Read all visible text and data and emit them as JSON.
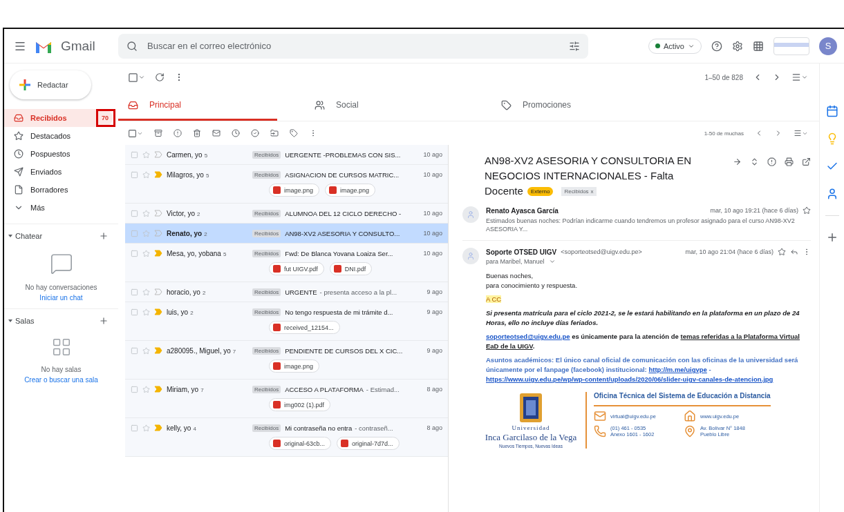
{
  "app": {
    "name": "Gmail"
  },
  "search": {
    "placeholder": "Buscar en el correo electrónico"
  },
  "status": {
    "label": "Activo"
  },
  "account": {
    "initial": "S"
  },
  "compose": {
    "label": "Redactar"
  },
  "sidebar": {
    "items": [
      {
        "kind": "inbox",
        "label": "Recibidos",
        "count": "70",
        "selected": true,
        "highlighted": true
      },
      {
        "kind": "starred",
        "label": "Destacados",
        "selected": false
      },
      {
        "kind": "snoozed",
        "label": "Pospuestos",
        "selected": false
      },
      {
        "kind": "sent",
        "label": "Enviados",
        "selected": false
      },
      {
        "kind": "drafts",
        "label": "Borradores",
        "selected": false
      },
      {
        "kind": "more",
        "label": "Más",
        "selected": false
      }
    ]
  },
  "chat": {
    "title": "Chatear",
    "empty": "No hay conversaciones",
    "link": "Iniciar un chat"
  },
  "rooms": {
    "title": "Salas",
    "empty": "No hay salas",
    "link": "Crear o buscar una sala"
  },
  "toolbar": {
    "range": "1–50 de 828"
  },
  "tabs": [
    {
      "kind": "primary",
      "label": "Principal",
      "selected": true
    },
    {
      "kind": "social",
      "label": "Social",
      "selected": false
    },
    {
      "kind": "promotions",
      "label": "Promociones",
      "selected": false
    }
  ],
  "list_toolbar": {
    "range": "1-50 de muchas"
  },
  "emails": [
    {
      "sender": "Carmen, yo",
      "count": "5",
      "label": "Recibidos",
      "subject": "UERGENTE -PROBLEMAS CON SIS...",
      "date": "10 ago",
      "important": false,
      "selected": false
    },
    {
      "sender": "Milagros, yo",
      "count": "5",
      "label": "Recibidos",
      "subject": "ASIGNACION DE CURSOS MATRIC...",
      "date": "10 ago",
      "important": true,
      "selected": false,
      "attachments": [
        "image.png",
        "image.png"
      ]
    },
    {
      "sender": "Victor, yo",
      "count": "2",
      "label": "Recibidos",
      "subject": "ALUMNOA DEL 12 CICLO DERECHO -",
      "date": "10 ago",
      "important": false,
      "selected": false
    },
    {
      "sender": "Renato, yo",
      "count": "2",
      "label": "Recibidos",
      "subject": "AN98-XV2 ASESORIA Y CONSULTO...",
      "date": "10 ago",
      "important": false,
      "selected": true
    },
    {
      "sender": "Mesa, yo, yobana",
      "count": "5",
      "label": "Recibidos",
      "subject": "Fwd: De Blanca Yovana Loaiza Ser...",
      "date": "10 ago",
      "important": true,
      "selected": false,
      "attachments": [
        "fut UIGV.pdf",
        "DNI.pdf"
      ]
    },
    {
      "sender": "horacio, yo",
      "count": "2",
      "label": "Recibidos",
      "subject": "URGENTE",
      "snippet": "- presenta acceso a la pl...",
      "date": "9 ago",
      "important": false,
      "selected": false
    },
    {
      "sender": "luis, yo",
      "count": "2",
      "label": "Recibidos",
      "subject": "No tengo respuesta de mi trámite d...",
      "date": "9 ago",
      "important": true,
      "selected": false,
      "attachments": [
        "received_12154..."
      ]
    },
    {
      "sender": "a280095., Miguel, yo",
      "count": "7",
      "label": "Recibidos",
      "subject": "PENDIENTE DE CURSOS DEL X CIC...",
      "date": "9 ago",
      "important": true,
      "selected": false,
      "attachments": [
        "image.png"
      ]
    },
    {
      "sender": "Miriam, yo",
      "count": "7",
      "label": "Recibidos",
      "subject": "ACCESO A PLATAFORMA",
      "snippet": "- Estimad...",
      "date": "8 ago",
      "important": true,
      "selected": false,
      "attachments": [
        "img002 (1).pdf"
      ]
    },
    {
      "sender": "kelly, yo",
      "count": "4",
      "label": "Recibidos",
      "subject": "Mi contraseña no entra",
      "snippet": "- contraseñ...",
      "date": "8 ago",
      "important": true,
      "selected": false,
      "attachments": [
        "original-63cb...",
        "original-7d7d..."
      ]
    }
  ],
  "thread": {
    "subject": "AN98-XV2 ASESORIA Y CONSULTORIA EN NEGOCIOS INTERNACIONALES - Falta Docente",
    "badge": "Externo",
    "label": "Recibidos",
    "label_remove": "x",
    "messages": [
      {
        "kind": "collapsed",
        "sender": "Renato Ayasca García",
        "date": "mar, 10 ago 19:21 (hace 6 días)",
        "snippet": "Estimados buenas noches: Podrían indicarme cuando tendremos un profesor asignado para el curso AN98-XV2 ASESORIA Y..."
      },
      {
        "kind": "expanded",
        "sender": "Soporte OTSED UIGV",
        "address": "<soporteotsed@uigv.edu.pe>",
        "date": "mar, 10 ago 21:04 (hace 6 días)",
        "to": "para Maribel, Manuel",
        "body": [
          {
            "kind": "plain",
            "segments": [
              {
                "kind": "text",
                "text": "Buenas noches,"
              }
            ]
          },
          {
            "kind": "plain",
            "segments": [
              {
                "kind": "text",
                "text": "para conocimiento y respuesta."
              }
            ]
          },
          {
            "kind": "highlight",
            "segments": [
              {
                "kind": "text",
                "text": "A CC"
              }
            ]
          },
          {
            "kind": "bold_italic",
            "segments": [
              {
                "kind": "text",
                "text": "Si presenta matrícula para el ciclo 2021-2, se le estará habilitando en la plataforma en un plazo de 24 Horas, ello no incluye días feriados."
              }
            ]
          },
          {
            "kind": "bold",
            "segments": [
              {
                "kind": "link",
                "text": "soporteotsed@uigv.edu.pe"
              },
              {
                "kind": "text",
                "text": " es únicamente para la atención de "
              },
              {
                "kind": "underline",
                "text": "temas referidas a la Plataforma Virtual EaD de la UIGV"
              },
              {
                "kind": "text",
                "text": "."
              }
            ]
          },
          {
            "kind": "notice",
            "segments": [
              {
                "kind": "text",
                "text": "Asuntos académicos: El único canal oficial de comunicación con las oficinas de la universidad será únicamente por el fanpage (facebook) institucional: "
              },
              {
                "kind": "link",
                "text": "http://m.me/uigvpe"
              },
              {
                "kind": "text",
                "text": " - "
              },
              {
                "kind": "link",
                "text": "https://www.uigv.edu.pe/wp/wp-content/uploads/2020/06/slider-uigv-canales-de-atencion.jpg"
              }
            ]
          }
        ],
        "signature": {
          "university_top": "Universidad",
          "university_name": "Inca Garcilaso de la Vega",
          "motto": "Nuevos Tiempos, Nuevas Ideas",
          "office": "Oficina Técnica del Sistema de Educación a Distancia",
          "contacts": [
            {
              "kind": "mail",
              "lines": [
                "virtual@uigv.edu.pe"
              ]
            },
            {
              "kind": "web",
              "lines": [
                "www.uigv.edu.pe"
              ]
            },
            {
              "kind": "phone",
              "lines": [
                "(01) 461 - 0535",
                "Anexo 1601 - 1602"
              ]
            },
            {
              "kind": "address",
              "lines": [
                "Av. Bolívar N° 1848",
                "Pueblo Libre"
              ]
            }
          ]
        }
      }
    ]
  }
}
